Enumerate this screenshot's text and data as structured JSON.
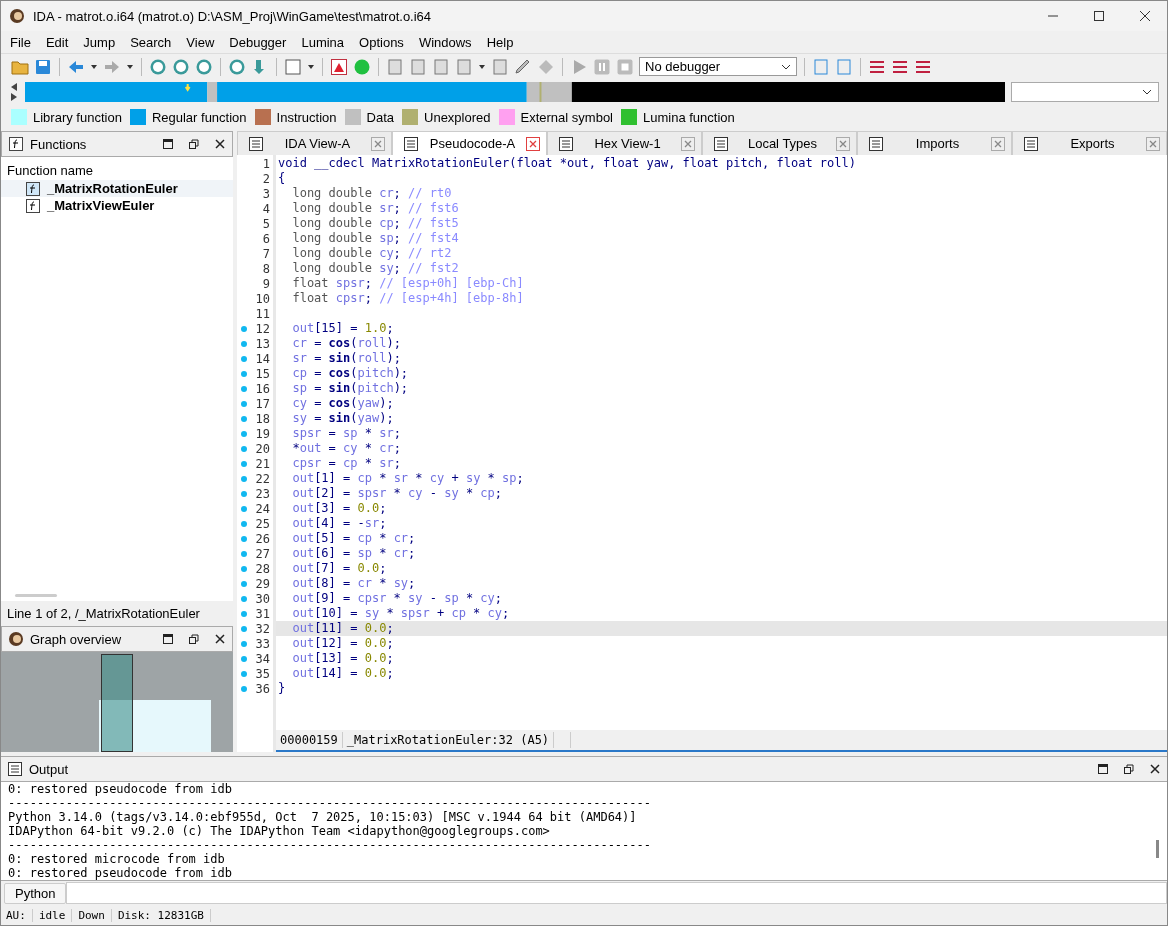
{
  "window": {
    "title": "IDA - matrot.o.i64 (matrot.o) D:\\ASM_Proj\\WinGame\\test\\matrot.o.i64"
  },
  "menu": [
    "File",
    "Edit",
    "Jump",
    "Search",
    "View",
    "Debugger",
    "Lumina",
    "Options",
    "Windows",
    "Help"
  ],
  "toolbar": {
    "debugger_select": "No debugger"
  },
  "legend": [
    {
      "label": "Library function",
      "color": "#aaffff"
    },
    {
      "label": "Regular function",
      "color": "#00a0e8"
    },
    {
      "label": "Instruction",
      "color": "#b87050"
    },
    {
      "label": "Data",
      "color": "#c0c0c0"
    },
    {
      "label": "Unexplored",
      "color": "#b0b070"
    },
    {
      "label": "External symbol",
      "color": "#ffa0f0"
    },
    {
      "label": "Lumina function",
      "color": "#30c030"
    }
  ],
  "functions_panel": {
    "title": "Functions",
    "column": "Function name",
    "items": [
      {
        "name": "_MatrixRotationEuler",
        "selected": true
      },
      {
        "name": "_MatrixViewEuler",
        "selected": false
      }
    ],
    "status": "Line 1 of 2, /_MatrixRotationEuler"
  },
  "graph_overview": {
    "title": "Graph overview"
  },
  "tabs": [
    {
      "label": "IDA View-A",
      "selected": false
    },
    {
      "label": "Pseudocode-A",
      "selected": true
    },
    {
      "label": "Hex View-1",
      "selected": false
    },
    {
      "label": "Local Types",
      "selected": false
    },
    {
      "label": "Imports",
      "selected": false
    },
    {
      "label": "Exports",
      "selected": false
    }
  ],
  "code": {
    "lines": [
      {
        "num": "1",
        "marked": false,
        "selected": false,
        "tokens": [
          {
            "kind": "t",
            "text": "void __cdecl MatrixRotationEuler(float *out, float yaw, float pitch, float roll)"
          }
        ]
      },
      {
        "num": "2",
        "marked": false,
        "selected": false,
        "tokens": [
          {
            "kind": "t",
            "text": "{"
          }
        ]
      },
      {
        "num": "3",
        "marked": false,
        "selected": false,
        "tokens": [
          {
            "kind": "k",
            "text": "  long double "
          },
          {
            "kind": "v",
            "text": "cr"
          },
          {
            "kind": "t",
            "text": ";"
          },
          {
            "kind": "c",
            "text": " // rt0"
          }
        ]
      },
      {
        "num": "4",
        "marked": false,
        "selected": false,
        "tokens": [
          {
            "kind": "k",
            "text": "  long double "
          },
          {
            "kind": "v",
            "text": "sr"
          },
          {
            "kind": "t",
            "text": ";"
          },
          {
            "kind": "c",
            "text": " // fst6"
          }
        ]
      },
      {
        "num": "5",
        "marked": false,
        "selected": false,
        "tokens": [
          {
            "kind": "k",
            "text": "  long double "
          },
          {
            "kind": "v",
            "text": "cp"
          },
          {
            "kind": "t",
            "text": ";"
          },
          {
            "kind": "c",
            "text": " // fst5"
          }
        ]
      },
      {
        "num": "6",
        "marked": false,
        "selected": false,
        "tokens": [
          {
            "kind": "k",
            "text": "  long double "
          },
          {
            "kind": "v",
            "text": "sp"
          },
          {
            "kind": "t",
            "text": ";"
          },
          {
            "kind": "c",
            "text": " // fst4"
          }
        ]
      },
      {
        "num": "7",
        "marked": false,
        "selected": false,
        "tokens": [
          {
            "kind": "k",
            "text": "  long double "
          },
          {
            "kind": "v",
            "text": "cy"
          },
          {
            "kind": "t",
            "text": ";"
          },
          {
            "kind": "c",
            "text": " // rt2"
          }
        ]
      },
      {
        "num": "8",
        "marked": false,
        "selected": false,
        "tokens": [
          {
            "kind": "k",
            "text": "  long double "
          },
          {
            "kind": "v",
            "text": "sy"
          },
          {
            "kind": "t",
            "text": ";"
          },
          {
            "kind": "c",
            "text": " // fst2"
          }
        ]
      },
      {
        "num": "9",
        "marked": false,
        "selected": false,
        "tokens": [
          {
            "kind": "k",
            "text": "  float "
          },
          {
            "kind": "v",
            "text": "spsr"
          },
          {
            "kind": "t",
            "text": ";"
          },
          {
            "kind": "c",
            "text": " // [esp+0h] [ebp-Ch]"
          }
        ]
      },
      {
        "num": "10",
        "marked": false,
        "selected": false,
        "tokens": [
          {
            "kind": "k",
            "text": "  float "
          },
          {
            "kind": "v",
            "text": "cpsr"
          },
          {
            "kind": "t",
            "text": ";"
          },
          {
            "kind": "c",
            "text": " // [esp+4h] [ebp-8h]"
          }
        ]
      },
      {
        "num": "11",
        "marked": false,
        "selected": false
      },
      {
        "num": "12",
        "marked": true,
        "selected": false,
        "tokens": [
          {
            "kind": "v",
            "text": "  out"
          },
          {
            "kind": "t",
            "text": "[15] = "
          },
          {
            "kind": "n",
            "text": "1.0"
          },
          {
            "kind": "t",
            "text": ";"
          }
        ]
      },
      {
        "num": "13",
        "marked": true,
        "selected": false,
        "tokens": [
          {
            "kind": "v",
            "text": "  cr"
          },
          {
            "kind": "t",
            "text": " = "
          },
          {
            "kind": "f",
            "text": "cos"
          },
          {
            "kind": "t",
            "text": "("
          },
          {
            "kind": "v",
            "text": "roll"
          },
          {
            "kind": "t",
            "text": ");"
          }
        ]
      },
      {
        "num": "14",
        "marked": true,
        "selected": false,
        "tokens": [
          {
            "kind": "v",
            "text": "  sr"
          },
          {
            "kind": "t",
            "text": " = "
          },
          {
            "kind": "f",
            "text": "sin"
          },
          {
            "kind": "t",
            "text": "("
          },
          {
            "kind": "v",
            "text": "roll"
          },
          {
            "kind": "t",
            "text": ");"
          }
        ]
      },
      {
        "num": "15",
        "marked": true,
        "selected": false,
        "tokens": [
          {
            "kind": "v",
            "text": "  cp"
          },
          {
            "kind": "t",
            "text": " = "
          },
          {
            "kind": "f",
            "text": "cos"
          },
          {
            "kind": "t",
            "text": "("
          },
          {
            "kind": "v",
            "text": "pitch"
          },
          {
            "kind": "t",
            "text": ");"
          }
        ]
      },
      {
        "num": "16",
        "marked": true,
        "selected": false,
        "tokens": [
          {
            "kind": "v",
            "text": "  sp"
          },
          {
            "kind": "t",
            "text": " = "
          },
          {
            "kind": "f",
            "text": "sin"
          },
          {
            "kind": "t",
            "text": "("
          },
          {
            "kind": "v",
            "text": "pitch"
          },
          {
            "kind": "t",
            "text": ");"
          }
        ]
      },
      {
        "num": "17",
        "marked": true,
        "selected": false,
        "tokens": [
          {
            "kind": "v",
            "text": "  cy"
          },
          {
            "kind": "t",
            "text": " = "
          },
          {
            "kind": "f",
            "text": "cos"
          },
          {
            "kind": "t",
            "text": "("
          },
          {
            "kind": "v",
            "text": "yaw"
          },
          {
            "kind": "t",
            "text": ");"
          }
        ]
      },
      {
        "num": "18",
        "marked": true,
        "selected": false,
        "tokens": [
          {
            "kind": "v",
            "text": "  sy"
          },
          {
            "kind": "t",
            "text": " = "
          },
          {
            "kind": "f",
            "text": "sin"
          },
          {
            "kind": "t",
            "text": "("
          },
          {
            "kind": "v",
            "text": "yaw"
          },
          {
            "kind": "t",
            "text": ");"
          }
        ]
      },
      {
        "num": "19",
        "marked": true,
        "selected": false,
        "tokens": [
          {
            "kind": "v",
            "text": "  spsr"
          },
          {
            "kind": "t",
            "text": " = "
          },
          {
            "kind": "v",
            "text": "sp"
          },
          {
            "kind": "t",
            "text": " * "
          },
          {
            "kind": "v",
            "text": "sr"
          },
          {
            "kind": "t",
            "text": ";"
          }
        ]
      },
      {
        "num": "20",
        "marked": true,
        "selected": false,
        "tokens": [
          {
            "kind": "t",
            "text": "  *"
          },
          {
            "kind": "v",
            "text": "out"
          },
          {
            "kind": "t",
            "text": " = "
          },
          {
            "kind": "v",
            "text": "cy"
          },
          {
            "kind": "t",
            "text": " * "
          },
          {
            "kind": "v",
            "text": "cr"
          },
          {
            "kind": "t",
            "text": ";"
          }
        ]
      },
      {
        "num": "21",
        "marked": true,
        "selected": false,
        "tokens": [
          {
            "kind": "v",
            "text": "  cpsr"
          },
          {
            "kind": "t",
            "text": " = "
          },
          {
            "kind": "v",
            "text": "cp"
          },
          {
            "kind": "t",
            "text": " * "
          },
          {
            "kind": "v",
            "text": "sr"
          },
          {
            "kind": "t",
            "text": ";"
          }
        ]
      },
      {
        "num": "22",
        "marked": true,
        "selected": false,
        "tokens": [
          {
            "kind": "v",
            "text": "  out"
          },
          {
            "kind": "t",
            "text": "[1] = "
          },
          {
            "kind": "v",
            "text": "cp"
          },
          {
            "kind": "t",
            "text": " * "
          },
          {
            "kind": "v",
            "text": "sr"
          },
          {
            "kind": "t",
            "text": " * "
          },
          {
            "kind": "v",
            "text": "cy"
          },
          {
            "kind": "t",
            "text": " + "
          },
          {
            "kind": "v",
            "text": "sy"
          },
          {
            "kind": "t",
            "text": " * "
          },
          {
            "kind": "v",
            "text": "sp"
          },
          {
            "kind": "t",
            "text": ";"
          }
        ]
      },
      {
        "num": "23",
        "marked": true,
        "selected": false,
        "tokens": [
          {
            "kind": "v",
            "text": "  out"
          },
          {
            "kind": "t",
            "text": "[2] = "
          },
          {
            "kind": "v",
            "text": "spsr"
          },
          {
            "kind": "t",
            "text": " * "
          },
          {
            "kind": "v",
            "text": "cy"
          },
          {
            "kind": "t",
            "text": " - "
          },
          {
            "kind": "v",
            "text": "sy"
          },
          {
            "kind": "t",
            "text": " * "
          },
          {
            "kind": "v",
            "text": "cp"
          },
          {
            "kind": "t",
            "text": ";"
          }
        ]
      },
      {
        "num": "24",
        "marked": true,
        "selected": false,
        "tokens": [
          {
            "kind": "v",
            "text": "  out"
          },
          {
            "kind": "t",
            "text": "[3] = "
          },
          {
            "kind": "n",
            "text": "0.0"
          },
          {
            "kind": "t",
            "text": ";"
          }
        ]
      },
      {
        "num": "25",
        "marked": true,
        "selected": false,
        "tokens": [
          {
            "kind": "v",
            "text": "  out"
          },
          {
            "kind": "t",
            "text": "[4] = -"
          },
          {
            "kind": "v",
            "text": "sr"
          },
          {
            "kind": "t",
            "text": ";"
          }
        ]
      },
      {
        "num": "26",
        "marked": true,
        "selected": false,
        "tokens": [
          {
            "kind": "v",
            "text": "  out"
          },
          {
            "kind": "t",
            "text": "[5] = "
          },
          {
            "kind": "v",
            "text": "cp"
          },
          {
            "kind": "t",
            "text": " * "
          },
          {
            "kind": "v",
            "text": "cr"
          },
          {
            "kind": "t",
            "text": ";"
          }
        ]
      },
      {
        "num": "27",
        "marked": true,
        "selected": false,
        "tokens": [
          {
            "kind": "v",
            "text": "  out"
          },
          {
            "kind": "t",
            "text": "[6] = "
          },
          {
            "kind": "v",
            "text": "sp"
          },
          {
            "kind": "t",
            "text": " * "
          },
          {
            "kind": "v",
            "text": "cr"
          },
          {
            "kind": "t",
            "text": ";"
          }
        ]
      },
      {
        "num": "28",
        "marked": true,
        "selected": false,
        "tokens": [
          {
            "kind": "v",
            "text": "  out"
          },
          {
            "kind": "t",
            "text": "[7] = "
          },
          {
            "kind": "n",
            "text": "0.0"
          },
          {
            "kind": "t",
            "text": ";"
          }
        ]
      },
      {
        "num": "29",
        "marked": true,
        "selected": false,
        "tokens": [
          {
            "kind": "v",
            "text": "  out"
          },
          {
            "kind": "t",
            "text": "[8] = "
          },
          {
            "kind": "v",
            "text": "cr"
          },
          {
            "kind": "t",
            "text": " * "
          },
          {
            "kind": "v",
            "text": "sy"
          },
          {
            "kind": "t",
            "text": ";"
          }
        ]
      },
      {
        "num": "30",
        "marked": true,
        "selected": false,
        "tokens": [
          {
            "kind": "v",
            "text": "  out"
          },
          {
            "kind": "t",
            "text": "[9] = "
          },
          {
            "kind": "v",
            "text": "cpsr"
          },
          {
            "kind": "t",
            "text": " * "
          },
          {
            "kind": "v",
            "text": "sy"
          },
          {
            "kind": "t",
            "text": " - "
          },
          {
            "kind": "v",
            "text": "sp"
          },
          {
            "kind": "t",
            "text": " * "
          },
          {
            "kind": "v",
            "text": "cy"
          },
          {
            "kind": "t",
            "text": ";"
          }
        ]
      },
      {
        "num": "31",
        "marked": true,
        "selected": false,
        "tokens": [
          {
            "kind": "v",
            "text": "  out"
          },
          {
            "kind": "t",
            "text": "[10] = "
          },
          {
            "kind": "v",
            "text": "sy"
          },
          {
            "kind": "t",
            "text": " * "
          },
          {
            "kind": "v",
            "text": "spsr"
          },
          {
            "kind": "t",
            "text": " + "
          },
          {
            "kind": "v",
            "text": "cp"
          },
          {
            "kind": "t",
            "text": " * "
          },
          {
            "kind": "v",
            "text": "cy"
          },
          {
            "kind": "t",
            "text": ";"
          }
        ]
      },
      {
        "num": "32",
        "marked": true,
        "selected": true,
        "tokens": [
          {
            "kind": "v",
            "text": "  out"
          },
          {
            "kind": "t",
            "text": "[11] = "
          },
          {
            "kind": "n",
            "text": "0.0"
          },
          {
            "kind": "t",
            "text": ";"
          }
        ]
      },
      {
        "num": "33",
        "marked": true,
        "selected": false,
        "tokens": [
          {
            "kind": "v",
            "text": "  out"
          },
          {
            "kind": "t",
            "text": "[12] = "
          },
          {
            "kind": "n",
            "text": "0.0"
          },
          {
            "kind": "t",
            "text": ";"
          }
        ]
      },
      {
        "num": "34",
        "marked": true,
        "selected": false,
        "tokens": [
          {
            "kind": "v",
            "text": "  out"
          },
          {
            "kind": "t",
            "text": "[13] = "
          },
          {
            "kind": "n",
            "text": "0.0"
          },
          {
            "kind": "t",
            "text": ";"
          }
        ]
      },
      {
        "num": "35",
        "marked": true,
        "selected": false,
        "tokens": [
          {
            "kind": "v",
            "text": "  out"
          },
          {
            "kind": "t",
            "text": "[14] = "
          },
          {
            "kind": "n",
            "text": "0.0"
          },
          {
            "kind": "t",
            "text": ";"
          }
        ]
      },
      {
        "num": "36",
        "marked": true,
        "selected": false,
        "tokens": [
          {
            "kind": "t",
            "text": "}"
          }
        ]
      }
    ],
    "status": {
      "address": "00000159",
      "location": "_MatrixRotationEuler:32 (A5)"
    }
  },
  "output": {
    "title": "Output",
    "lines": [
      "0: restored pseudocode from idb",
      "-----------------------------------------------------------------------------------------",
      "Python 3.14.0 (tags/v3.14.0:ebf955d, Oct  7 2025, 10:15:03) [MSC v.1944 64 bit (AMD64)]",
      "IDAPython 64-bit v9.2.0 (c) The IDAPython Team <idapython@googlegroups.com>",
      "-----------------------------------------------------------------------------------------",
      "0: restored microcode from idb",
      "0: restored pseudocode from idb"
    ],
    "cli_button": "Python"
  },
  "status_bar": [
    "AU:",
    "idle",
    "Down",
    "Disk: 12831GB"
  ]
}
